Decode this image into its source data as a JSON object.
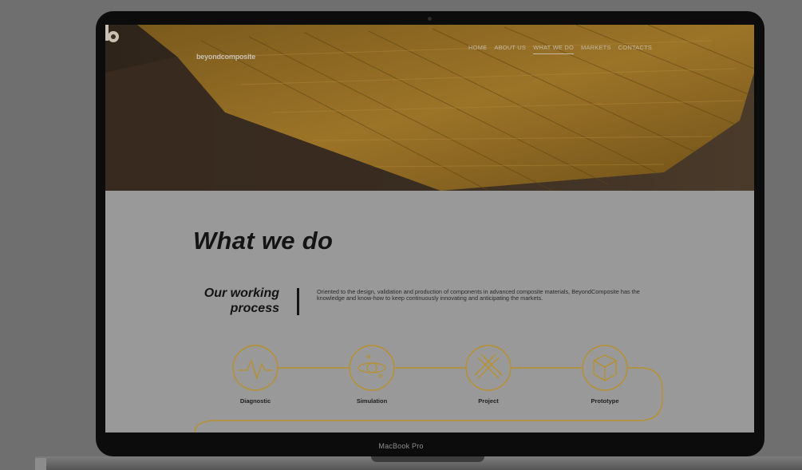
{
  "device": {
    "model_label": "MacBook Pro"
  },
  "header": {
    "logo_text": "beyondcomposite",
    "nav": [
      {
        "label": "HOME",
        "active": false
      },
      {
        "label": "ABOUT US",
        "active": false
      },
      {
        "label": "WHAT WE DO",
        "active": true
      },
      {
        "label": "MARKETS",
        "active": false
      },
      {
        "label": "CONTACTS",
        "active": false
      }
    ]
  },
  "main": {
    "title": "What we do",
    "subtitle_line1": "Our working",
    "subtitle_line2": "process",
    "intro": "Oriented to the design, validation and production of components in advanced composite materials, BeyondComposite has the knowledge and know-how to keep continuously innovating and anticipating the markets.",
    "steps": [
      {
        "label": "Diagnostic",
        "icon": "heartbeat-icon"
      },
      {
        "label": "Simulation",
        "icon": "orbit-icon"
      },
      {
        "label": "Project",
        "icon": "ruler-pencil-icon"
      },
      {
        "label": "Prototype",
        "icon": "cube-icon"
      }
    ]
  },
  "colors": {
    "accent": "#b8902c",
    "hero_wood": "#9a7126",
    "page_bg": "#999999",
    "text": "#141414"
  }
}
